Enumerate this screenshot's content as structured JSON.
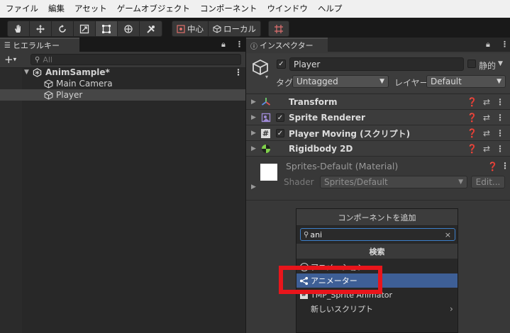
{
  "menu": [
    "ファイル",
    "編集",
    "アセット",
    "ゲームオブジェクト",
    "コンポーネント",
    "ウインドウ",
    "ヘルプ"
  ],
  "toolbar": {
    "pivot_label": "中心",
    "space_label": "ローカル"
  },
  "hierarchy": {
    "tab_label": "ヒエラルキー",
    "search_placeholder": "All",
    "scene_name": "AnimSample*",
    "objects": [
      "Main Camera",
      "Player"
    ]
  },
  "inspector": {
    "tab_label": "インスペクター",
    "object_name": "Player",
    "static_label": "静的",
    "tag_label": "タグ",
    "tag_value": "Untagged",
    "layer_label": "レイヤー",
    "layer_value": "Default",
    "components": [
      {
        "name": "Transform",
        "checkbox": false
      },
      {
        "name": "Sprite Renderer",
        "checkbox": true
      },
      {
        "name": "Player Moving (スクリプト)",
        "checkbox": true
      },
      {
        "name": "Rigidbody 2D",
        "checkbox": false
      }
    ],
    "material": {
      "name": "Sprites-Default (Material)",
      "shader_label": "Shader",
      "shader_value": "Sprites/Default",
      "edit_label": "Edit..."
    }
  },
  "add_component": {
    "title": "コンポーネントを追加",
    "search_value": "ani",
    "section_label": "検索",
    "items": [
      "アニメーション",
      "アニメーター",
      "TMP_Sprite Animator",
      "新しいスクリプト"
    ],
    "selected_index": 1,
    "highlight_color": "#e8151b"
  },
  "colors": {
    "selection": "#3e5f96",
    "background": "#383838"
  }
}
